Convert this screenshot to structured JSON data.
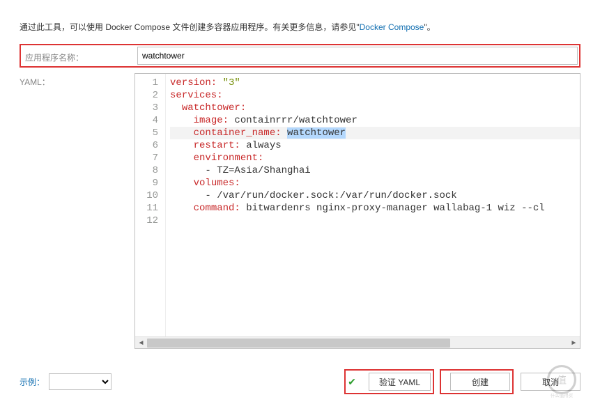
{
  "intro": {
    "prefix": "通过此工具，可以使用 Docker Compose 文件创建多容器应用程序。有关更多信息，请参见\"",
    "link": "Docker Compose",
    "suffix": "\"。"
  },
  "form": {
    "app_name_label": "应用程序名称：",
    "app_name_value": "watchtower",
    "yaml_label": "YAML："
  },
  "editor": {
    "line_numbers": [
      "1",
      "2",
      "3",
      "4",
      "5",
      "6",
      "7",
      "8",
      "9",
      "10",
      "11",
      "12"
    ],
    "lines": [
      {
        "tokens": [
          {
            "t": "version:",
            "c": "kk"
          },
          {
            "t": " ",
            "c": "plain"
          },
          {
            "t": "\"3\"",
            "c": "v-str"
          }
        ]
      },
      {
        "tokens": [
          {
            "t": "services:",
            "c": "kk"
          }
        ]
      },
      {
        "tokens": [
          {
            "t": "  ",
            "c": "plain"
          },
          {
            "t": "watchtower:",
            "c": "kk"
          }
        ]
      },
      {
        "tokens": [
          {
            "t": "    ",
            "c": "plain"
          },
          {
            "t": "image:",
            "c": "kk"
          },
          {
            "t": " containrrr/watchtower",
            "c": "plain"
          }
        ]
      },
      {
        "active": true,
        "tokens": [
          {
            "t": "    ",
            "c": "plain"
          },
          {
            "t": "container_name:",
            "c": "kk"
          },
          {
            "t": " ",
            "c": "plain"
          },
          {
            "t": "watchtower",
            "c": "plain sel"
          }
        ]
      },
      {
        "tokens": [
          {
            "t": "    ",
            "c": "plain"
          },
          {
            "t": "restart:",
            "c": "kk"
          },
          {
            "t": " always",
            "c": "plain"
          }
        ]
      },
      {
        "tokens": [
          {
            "t": "    ",
            "c": "plain"
          },
          {
            "t": "environment:",
            "c": "kk"
          }
        ]
      },
      {
        "tokens": [
          {
            "t": "      - TZ=Asia/Shanghai",
            "c": "plain"
          }
        ]
      },
      {
        "tokens": [
          {
            "t": "    ",
            "c": "plain"
          },
          {
            "t": "volumes:",
            "c": "kk"
          }
        ]
      },
      {
        "tokens": [
          {
            "t": "      - /var/run/docker.sock:/var/run/docker.sock",
            "c": "plain"
          }
        ]
      },
      {
        "tokens": [
          {
            "t": "    ",
            "c": "plain"
          },
          {
            "t": "command:",
            "c": "kk"
          },
          {
            "t": " bitwardenrs nginx-proxy-manager wallabag-1 wiz --cl",
            "c": "plain"
          }
        ]
      },
      {
        "tokens": [
          {
            "t": "",
            "c": "plain"
          }
        ]
      }
    ]
  },
  "footer": {
    "example_label": "示例：",
    "example_value": "",
    "validate_label": "验证 YAML",
    "create_label": "创建",
    "cancel_label": "取消"
  },
  "icons": {
    "check": "✔",
    "left": "◄",
    "right": "►"
  }
}
